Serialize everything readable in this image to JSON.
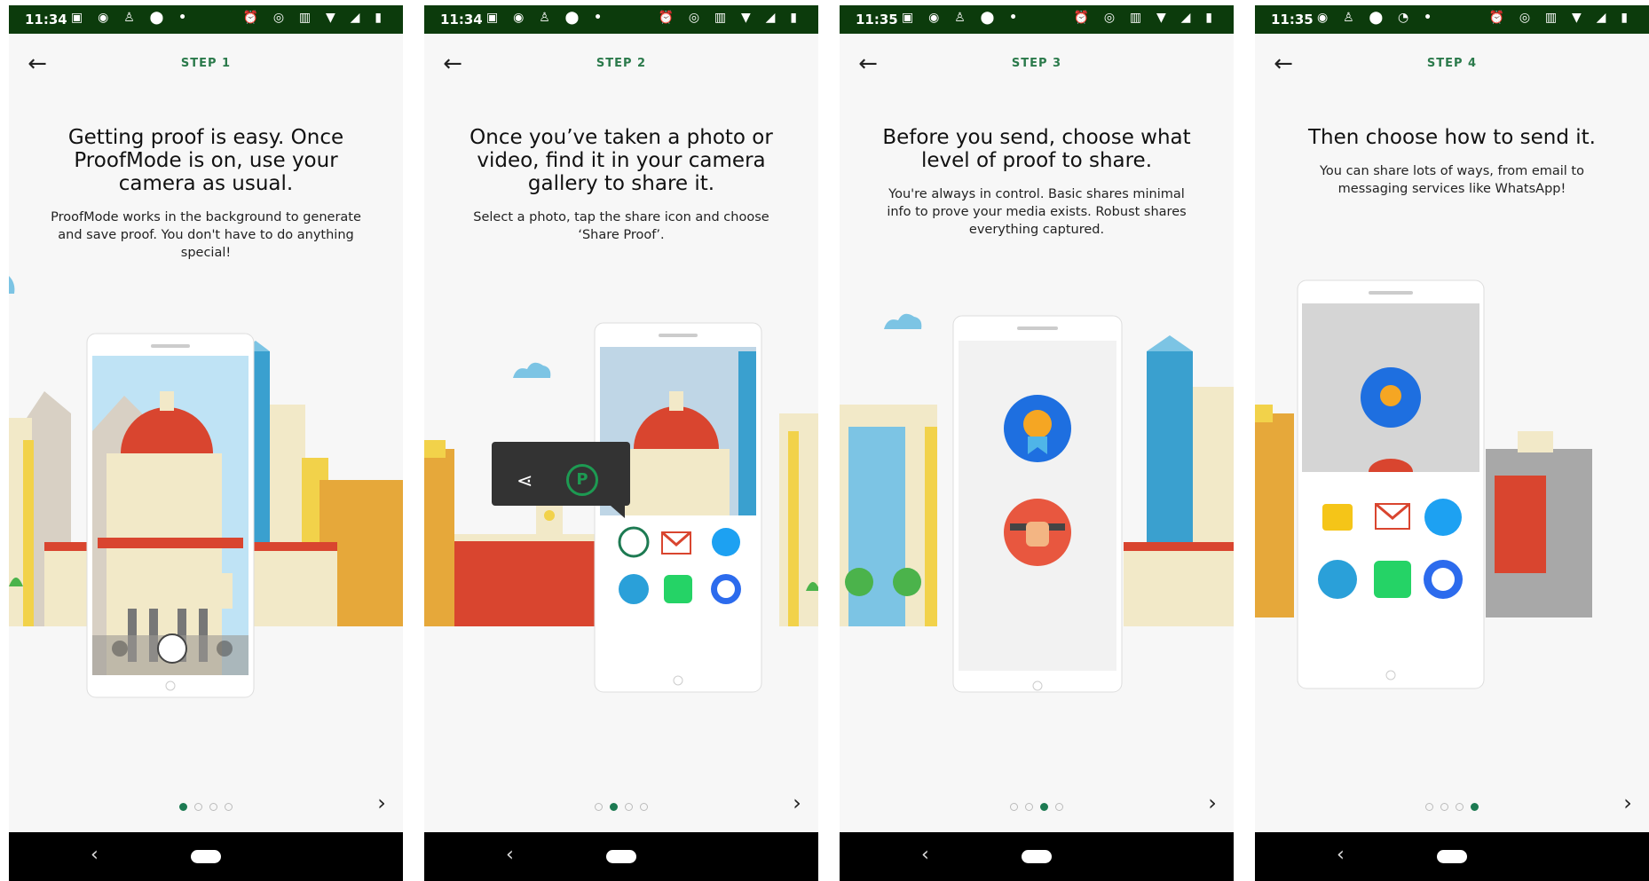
{
  "screens": [
    {
      "status_time": "11:34",
      "step_label": "STEP 1",
      "title": "Getting proof is easy. Once ProofMode is on, use your camera as usual.",
      "description": "ProofMode works in the background to generate and save proof. You don't have to do anything special!"
    },
    {
      "status_time": "11:34",
      "step_label": "STEP 2",
      "title": "Once you’ve taken a photo or video, find it in your camera gallery to share it.",
      "description": "Select a photo, tap the share icon and choose ‘Share Proof’."
    },
    {
      "status_time": "11:35",
      "step_label": "STEP 3",
      "title": "Before you send, choose what level of proof to share.",
      "description": "You're always in control. Basic shares minimal info to prove your media exists. Robust shares everything captured."
    },
    {
      "status_time": "11:35",
      "step_label": "STEP 4",
      "title": "Then choose how to send it.",
      "description": "You can share lots of ways, from email to messaging services like WhatsApp!"
    }
  ],
  "colors": {
    "status_bar": "#0c3b0c",
    "accent_green": "#2b7a4b",
    "dot_active": "#1d7a52",
    "nav_bar": "#000000",
    "sky_blue": "#bfe3f5",
    "dome_red": "#d9452f",
    "building_orange": "#e6a83a",
    "building_blue": "#3aa0cf",
    "whatsapp_green": "#25d366",
    "twitter_blue": "#1da1f2",
    "telegram_blue": "#2aa0d9",
    "signal_blue": "#2c6bed"
  },
  "icons": {
    "back": "arrow-left-icon",
    "next": "chevron-right-icon",
    "nav_back": "nav-back-icon",
    "nav_home": "nav-home-pill"
  }
}
